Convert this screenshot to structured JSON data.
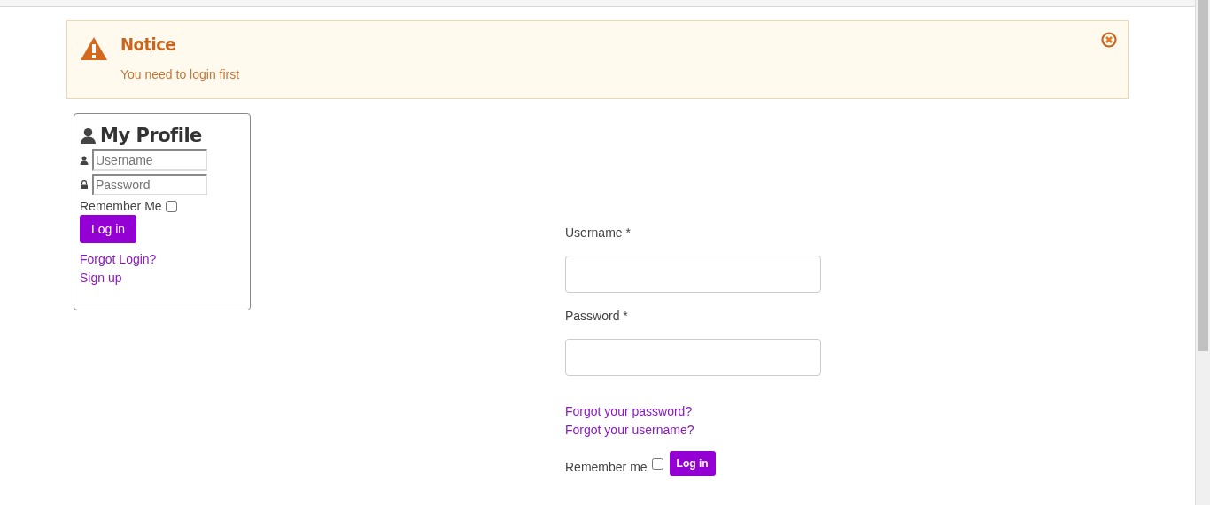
{
  "notice": {
    "title": "Notice",
    "message": "You need to login first"
  },
  "profile_module": {
    "title": "My Profile",
    "username": {
      "placeholder": "Username"
    },
    "password": {
      "placeholder": "Password"
    },
    "remember": {
      "label": "Remember Me",
      "checked": false
    },
    "login_button": "Log in",
    "links": [
      "Forgot Login?",
      "Sign up"
    ]
  },
  "login_form": {
    "username": {
      "label": "Username *"
    },
    "password": {
      "label": "Password *"
    },
    "links": [
      "Forgot your password?",
      "Forgot your username?"
    ],
    "remember": {
      "label": "Remember me",
      "checked": false
    },
    "login_button": "Log in"
  }
}
